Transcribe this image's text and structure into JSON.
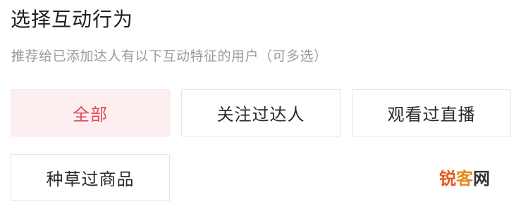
{
  "section": {
    "title": "选择互动行为",
    "subtitle": "推荐给已添加达人有以下互动特征的用户（可多选）"
  },
  "options": [
    {
      "label": "全部",
      "selected": true
    },
    {
      "label": "关注过达人",
      "selected": false
    },
    {
      "label": "观看过直播",
      "selected": false
    },
    {
      "label": "种草过商品",
      "selected": false
    }
  ],
  "watermark": {
    "part1": "锐",
    "part2": "客",
    "part3": "网"
  },
  "colors": {
    "selected_bg": "#fdeff0",
    "selected_text": "#e34a5a",
    "border": "#e4e4e4",
    "subtitle_text": "#9a9a9a"
  }
}
